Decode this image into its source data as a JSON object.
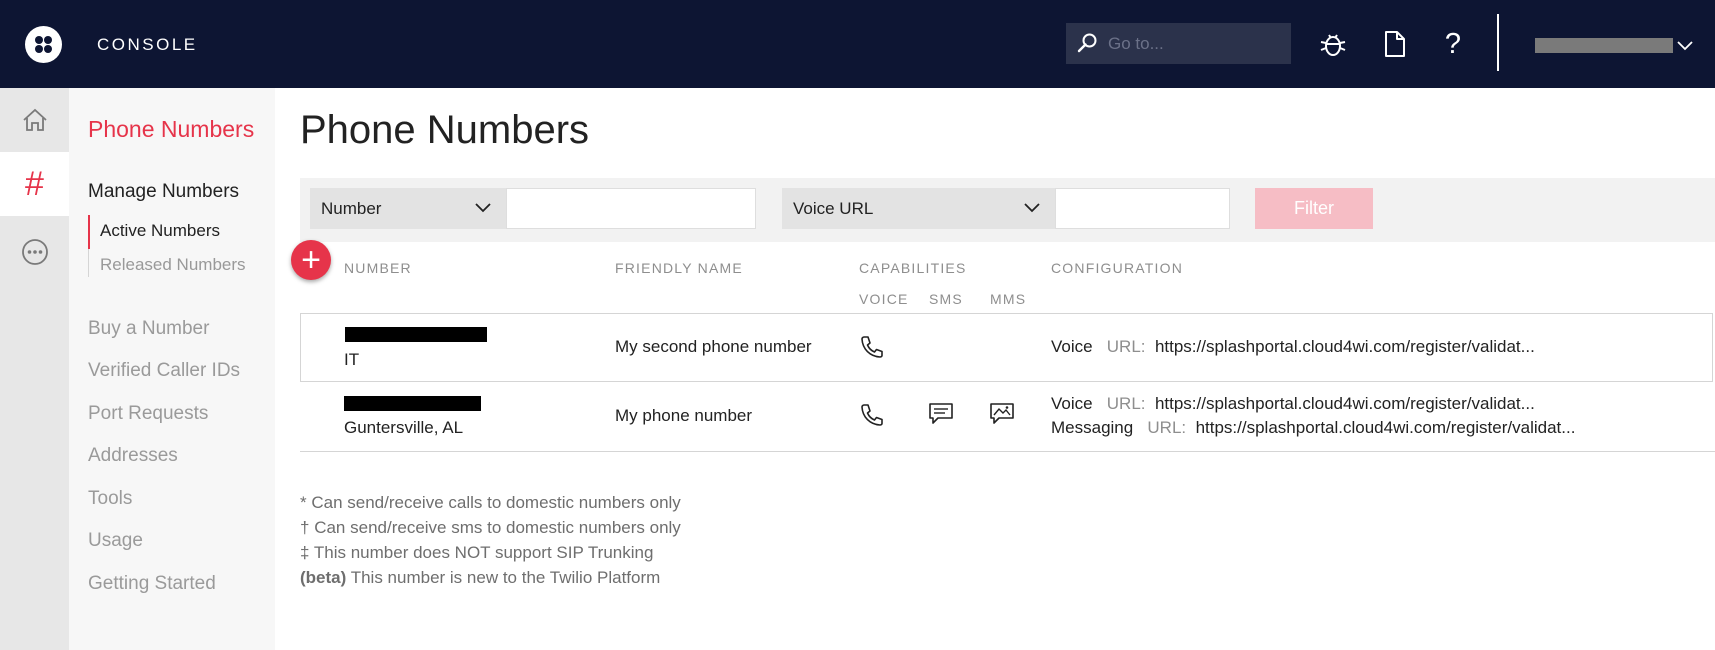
{
  "header": {
    "brand": "CONSOLE",
    "search_placeholder": "Go to...",
    "icons": [
      "bug-icon",
      "document-icon",
      "help-icon"
    ],
    "help_glyph": "?"
  },
  "rail": {
    "items": [
      "home-icon",
      "hash-icon",
      "more-icon"
    ],
    "hash_glyph": "#"
  },
  "subnav": {
    "section_title": "Phone Numbers",
    "group_title": "Manage Numbers",
    "sub_items": [
      "Active Numbers",
      "Released Numbers"
    ],
    "items": [
      "Buy a Number",
      "Verified Caller IDs",
      "Port Requests",
      "Addresses",
      "Tools",
      "Usage",
      "Getting Started"
    ]
  },
  "main": {
    "title": "Phone Numbers",
    "filter": {
      "select1": "Number",
      "select2": "Voice URL",
      "button": "Filter"
    },
    "add_glyph": "+",
    "columns": {
      "number": "NUMBER",
      "friendly_name": "FRIENDLY NAME",
      "capabilities": "CAPABILITIES",
      "configuration": "CONFIGURATION",
      "voice": "VOICE",
      "sms": "SMS",
      "mms": "MMS"
    },
    "rows": [
      {
        "location": "IT",
        "friendly_name": "My second phone number",
        "capabilities": [
          "voice"
        ],
        "config": [
          {
            "type": "Voice",
            "label": "URL:",
            "url": "https://splashportal.cloud4wi.com/register/validat..."
          }
        ]
      },
      {
        "location": "Guntersville, AL",
        "friendly_name": "My phone number",
        "capabilities": [
          "voice",
          "sms",
          "mms"
        ],
        "config": [
          {
            "type": "Voice",
            "label": "URL:",
            "url": "https://splashportal.cloud4wi.com/register/validat..."
          },
          {
            "type": "Messaging",
            "label": "URL:",
            "url": "https://splashportal.cloud4wi.com/register/validat..."
          }
        ]
      }
    ]
  },
  "notes": [
    {
      "mark": "*",
      "text": "Can send/receive calls to domestic numbers only"
    },
    {
      "mark": "†",
      "text": "Can send/receive sms to domestic numbers only"
    },
    {
      "mark": "‡",
      "text": "This number does NOT support SIP Trunking"
    },
    {
      "mark": "(beta)",
      "text": "This number is new to the Twilio Platform"
    }
  ],
  "colors": {
    "topbar": "#0d1533",
    "accent": "#e6344a",
    "filter_disabled": "#f6bdc5"
  }
}
